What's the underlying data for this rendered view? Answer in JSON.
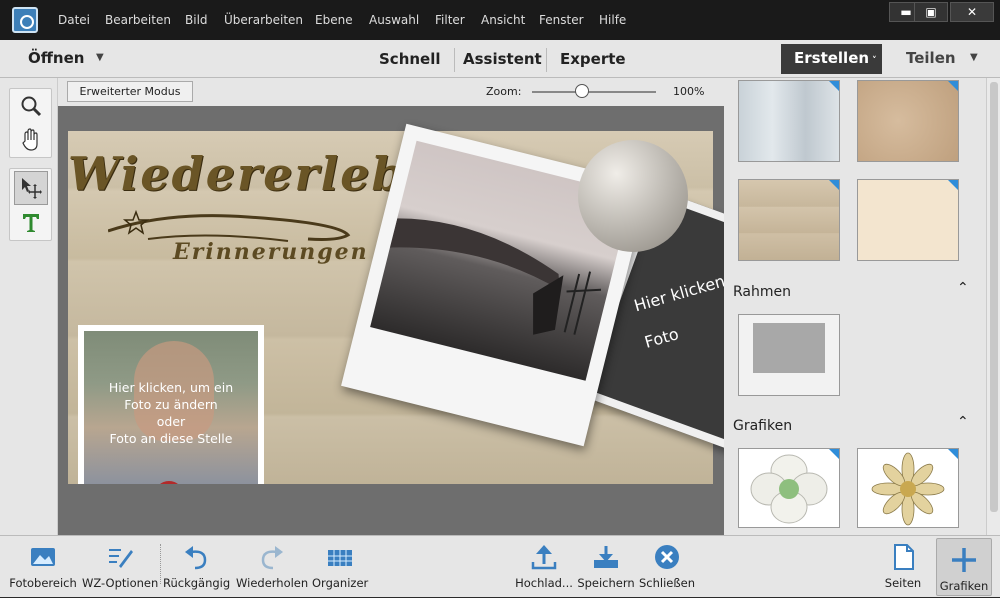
{
  "menu": [
    "Datei",
    "Bearbeiten",
    "Bild",
    "Überarbeiten",
    "Ebene",
    "Auswahl",
    "Filter",
    "Ansicht",
    "Fenster",
    "Hilfe"
  ],
  "window": {
    "minimize": "▬",
    "maximize": "▣",
    "close": "✕"
  },
  "modebar": {
    "open": "Öffnen",
    "tabs": [
      "Schnell",
      "Assistent",
      "Experte"
    ],
    "create": "Erstellen",
    "share": "Teilen"
  },
  "options": {
    "expert_mode": "Erweiterter Modus",
    "zoom_label": "Zoom:",
    "zoom_value": "100%",
    "zoom_level_pct": 100
  },
  "document": {
    "title": "Wiedererlebt",
    "subtitle": "Erinnerungen",
    "placeholder_text": [
      "Hier klicken, um ein",
      "Foto zu ändern",
      "oder",
      "Foto an diese Stelle"
    ],
    "second_photo_text": [
      "Hier klicken",
      "Foto"
    ]
  },
  "panel": {
    "sections": [
      {
        "title": "Rahmen"
      },
      {
        "title": "Grafiken"
      }
    ]
  },
  "taskbar": [
    {
      "label": "Fotobereich",
      "icon": "photo-bin-icon"
    },
    {
      "label": "WZ-Optionen",
      "icon": "tool-options-icon"
    },
    {
      "label": "Rückgängig",
      "icon": "undo-icon"
    },
    {
      "label": "Wiederholen",
      "icon": "redo-icon"
    },
    {
      "label": "Organizer",
      "icon": "organizer-icon"
    },
    {
      "label": "Hochlad...",
      "icon": "upload-icon"
    },
    {
      "label": "Speichern",
      "icon": "save-icon"
    },
    {
      "label": "Schließen",
      "icon": "close-circle-icon"
    },
    {
      "label": "Seiten",
      "icon": "pages-icon"
    },
    {
      "label": "Grafiken",
      "icon": "graphics-icon"
    }
  ],
  "colors": {
    "accent": "#2f8dd9",
    "dark": "#1a1a1a",
    "panel": "#e6e6e6"
  }
}
